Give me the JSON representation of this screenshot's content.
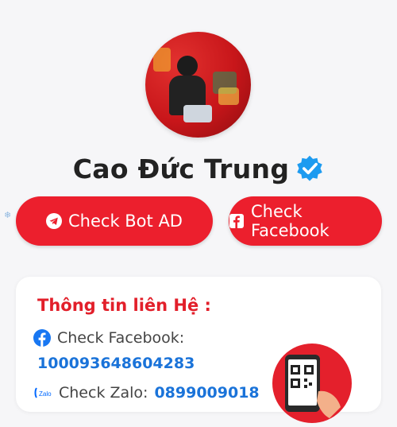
{
  "profile": {
    "name": "Cao Đức Trung"
  },
  "buttons": {
    "bot_label": "Check Bot AD",
    "facebook_label": "Check Facebook"
  },
  "contact": {
    "title": "Thông tin liên Hệ :",
    "facebook_label": "Check Facebook:",
    "facebook_id": "100093648604283",
    "zalo_label": "Check Zalo:",
    "zalo_number": "0899009018"
  },
  "icons": {
    "verified": "verified-badge-icon",
    "telegram": "telegram-icon",
    "facebook": "facebook-icon",
    "zalo": "zalo-icon",
    "qr": "qr-phone-icon",
    "snowflake": "snowflake-icon"
  },
  "colors": {
    "accent": "#ec1f2d",
    "link": "#1a73d9",
    "verified": "#1d9bf0"
  }
}
